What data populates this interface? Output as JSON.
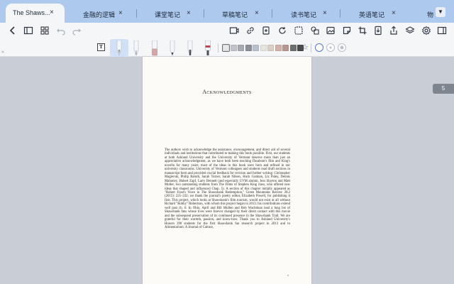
{
  "tabs": [
    {
      "label": "The Shaws...",
      "close": "×",
      "active": true
    },
    {
      "label": "金融的逻辑",
      "close": "×",
      "active": false
    },
    {
      "label": "课堂笔记",
      "close": "×",
      "active": false
    },
    {
      "label": "草稿笔记",
      "close": "×",
      "active": false
    },
    {
      "label": "读书笔记",
      "close": "×",
      "active": false
    },
    {
      "label": "英语笔记",
      "close": "×",
      "active": false
    },
    {
      "label": "物",
      "close": "",
      "active": false
    }
  ],
  "tab_more": "▼",
  "text_tool_glyph": "T",
  "collapse_glyph": "«",
  "star_glyph": "☆",
  "swatch_colors": [
    "#e8e8e8",
    "#c0c3c8",
    "#a7abb2",
    "#8c9096",
    "#b9c2cc",
    "#e8e3da",
    "#d9cfc4",
    "#d1b2ac",
    "#b69893",
    "#6f6f6f",
    "#4a4a4a"
  ],
  "selected_swatch": 0,
  "page": {
    "heading": "Acknowledgments",
    "body": "The authors wish to acknowledge the assistance, encouragement, and direct aid of several individuals and institutions that contributed to making this book possible. First, our students at both Ashland University and the University of Vermont deserve more than just an appreciative acknowledgment, as we have both been teaching Darabont's film and King's novella for many years; most of the ideas in this book were born and refined in our university classrooms. University of Vermont colleagues and students read draft sections in manuscript form and provided crucial feedback for revision and further writing: Christopher Magierski, Philip Baruth, Sarah Turner, Sarah Nilsen, Huck Gutman, Liz Paley, Dennis Mahoney, Hubert Zapf, Larry Bennett (and especially UVM alumni, Jess Slayton and Matt Muller, two outstanding students from The Films of Stephen King class, who offered new ideas that shaped and influenced Chap. 5). A section of this chapter initially appeared as \"Robert Frost's Voice in The Shawshank Redemption,\" Green Mountains Review 28.2 (2015): 225–232; we thank the journal's poetry editor, Elizabeth Powell, for publishing it first. This project, which looks at Shawshank's film tourism, would not exist at all without Richard \"Robby\" Robertson, with whom this project began in 2013; his contributions extend well past ch. 6. In Ohio, April and Bill Mullen and Bob Wachtman lead a long list of Shawshank fans whose lives were forever changed by their direct contact with this movie and the subsequent preservation of its continued presence in the Shawshank Trail. We are grateful for their warmth, passion, and know-how. Thank you to Ashland University's Honors 390 students for the first Shawshank fan research project in 2013 and to Alimentarium: A Journal of Culture,",
    "footer_page_number": "v"
  },
  "page_badge": "5"
}
